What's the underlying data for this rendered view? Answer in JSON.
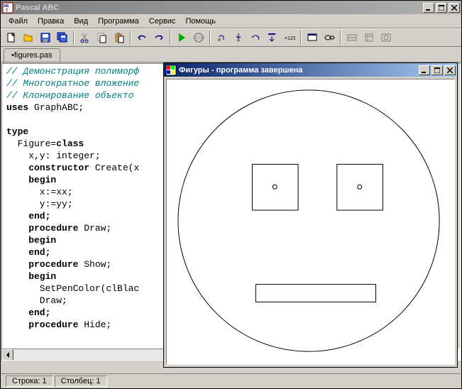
{
  "main": {
    "title": "Pascal ABC"
  },
  "menu": {
    "file": "Файл",
    "edit": "Правка",
    "view": "Вид",
    "program": "Программа",
    "service": "Сервис",
    "help": "Помощь"
  },
  "tabs": {
    "current": "•figures.pas"
  },
  "code": {
    "c1": "// Демонстрация полиморф",
    "c2": "// Многократное вложение",
    "c3": "// Клонирование объекто",
    "uses": "uses",
    "graphabc": " GraphABC;",
    "type": "type",
    "figure": "  Figure=",
    "class": "class",
    "xy": "    x,y: integer;",
    "constructor": "    constructor",
    "create": " Create(x",
    "begin1": "    begin",
    "xx": "      x:=xx;",
    "yy": "      y:=yy;",
    "end1": "    end;",
    "procedure": "    procedure",
    "draw": " Draw;",
    "begin2": "    begin",
    "end2": "    end;",
    "procedure2": "    procedure",
    "show": " Show;",
    "begin3": "    begin",
    "setpen": "      SetPenColor(clBlac",
    "draw2": "      Draw;",
    "end3": "    end;",
    "procedure3": "    procedure",
    "hide": " Hide;"
  },
  "status": {
    "line": "Строка: 1",
    "col": "Столбец: 1"
  },
  "child": {
    "title": "Фигуры - программа завершена"
  }
}
